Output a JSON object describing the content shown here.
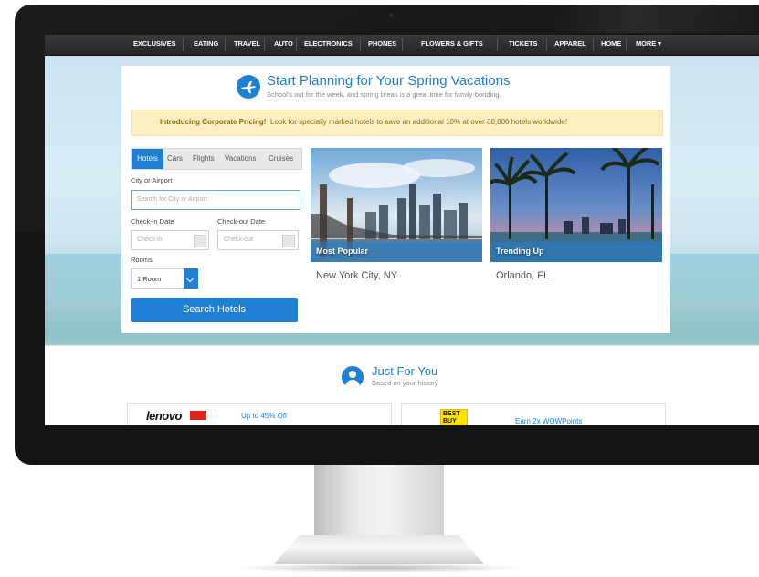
{
  "nav": {
    "items": [
      "EXCLUSIVES",
      "EATING",
      "TRAVEL",
      "AUTO",
      "ELECTRONICS",
      "PHONES",
      "FLOWERS & GIFTS",
      "TICKETS",
      "APPAREL",
      "HOME",
      "MORE ▾"
    ]
  },
  "header": {
    "title": "Start Planning for Your Spring Vacations",
    "subtitle": "School's out for the week, and spring break is a great time for family-bonding."
  },
  "promo": {
    "bold": "Introducing Corporate Pricing!",
    "text": "Look for specially marked hotels to save an additional 10% at over 60,000 hotels worldwide!"
  },
  "search": {
    "tabs": [
      "Hotels",
      "Cars",
      "Flights",
      "Vacations",
      "Cruises"
    ],
    "active_tab": "Hotels",
    "city_label": "City or Airport",
    "city_placeholder": "Search for City or Airport",
    "checkin_label": "Check-in Date",
    "checkin_placeholder": "Check-in",
    "checkout_label": "Check-out Date",
    "checkout_placeholder": "Check-out",
    "rooms_label": "Rooms",
    "rooms_value": "1 Room",
    "button": "Search Hotels"
  },
  "cards": [
    {
      "tag": "Most Popular",
      "city": "New York City, NY"
    },
    {
      "tag": "Trending Up",
      "city": "Orlando, FL"
    }
  ],
  "just_for_you": {
    "title": "Just For You",
    "subtitle": "Based on your history"
  },
  "offers": [
    {
      "brand": "lenovo",
      "text": "Up to 45% Off"
    },
    {
      "brand": "BEST BUY",
      "text": "Earn 2x WOWPoints"
    }
  ],
  "colors": {
    "accent": "#1f7fd3",
    "nav_bg": "#2e2e2e",
    "promo_bg": "#fcf0c3"
  }
}
